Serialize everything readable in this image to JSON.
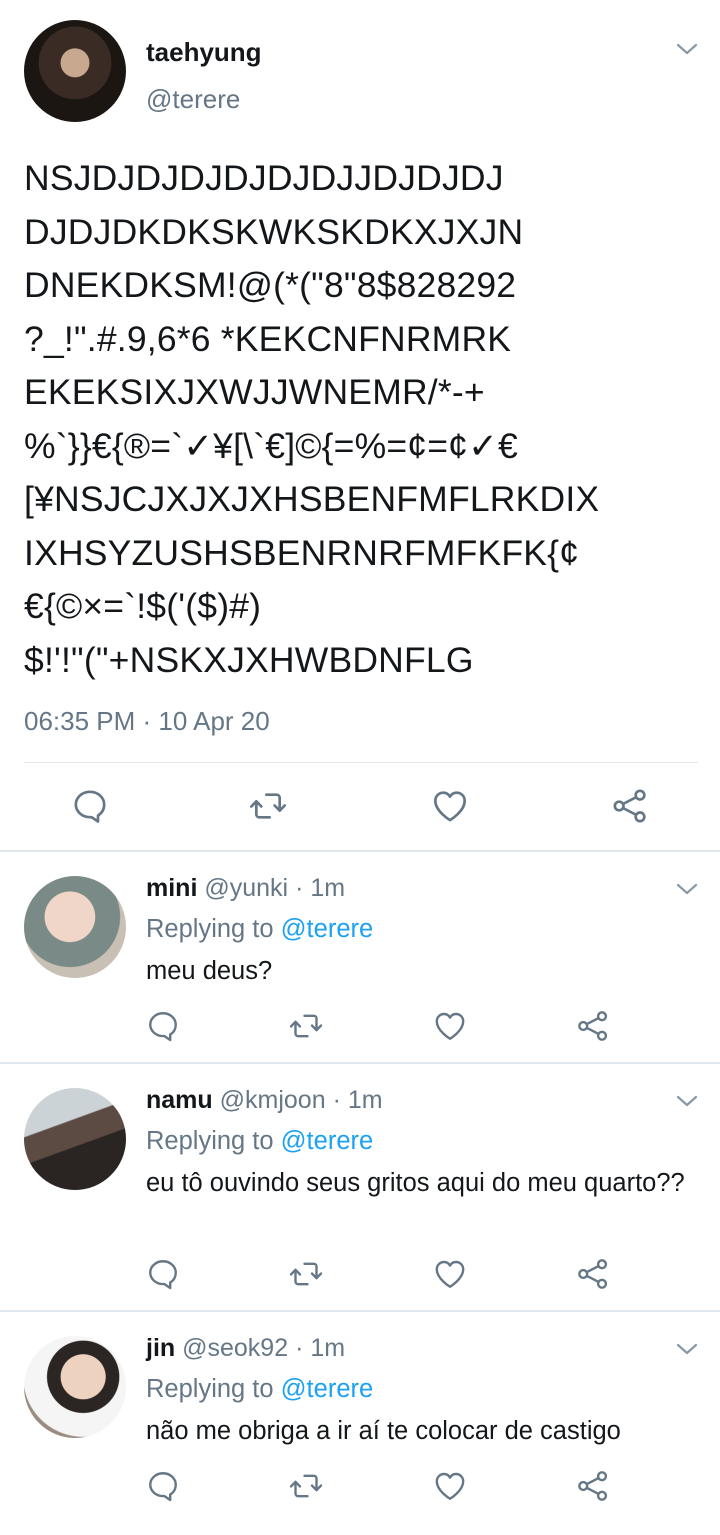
{
  "main_tweet": {
    "display_name": "taehyung",
    "handle": "@terere",
    "text_lines": [
      "NSJDJDJDJDJDJDJJDJDJDJ",
      "DJDJDKDKSKWKSKDKXJXJN",
      "DNEKDKSM!@(*(\"8\"8$828292",
      "?_!\".#.9,6*6 *KEKCNFNRMRK",
      "EKEKSIXJXWJJWNEMR/*-+",
      "%`}}€{®=`✓¥[\\`€]©{=%=¢=¢✓€",
      "[¥NSJCJXJXJXHSBENFMFLRKDIX",
      "IXHSYZUSHSBENRNRFMFKFK{¢",
      "€{©×=`!$('($)#)",
      "$!'!\"(\"+NSKXJXHWBDNFLG"
    ],
    "timestamp": "06:35 PM · 10 Apr 20"
  },
  "replies": [
    {
      "name": "mini",
      "handle": "@yunki",
      "time": "· 1m",
      "replying_prefix": "Replying to",
      "replying_to": "@terere",
      "text": "meu deus?"
    },
    {
      "name": "namu",
      "handle": "@kmjoon",
      "time": "· 1m",
      "replying_prefix": "Replying to",
      "replying_to": "@terere",
      "text": "eu tô ouvindo seus gritos aqui do meu quarto??"
    },
    {
      "name": "jin",
      "handle": "@seok92",
      "time": "· 1m",
      "replying_prefix": "Replying to",
      "replying_to": "@terere",
      "text": "não me obriga a ir aí te colocar de castigo"
    }
  ],
  "icons": {
    "reply": "reply-icon",
    "retweet": "retweet-icon",
    "like": "heart-icon",
    "share": "share-icon",
    "menu": "chevron-down-icon"
  },
  "colors": {
    "link": "#1da1f2",
    "secondary": "#657786",
    "divider": "#e1e8ed"
  }
}
